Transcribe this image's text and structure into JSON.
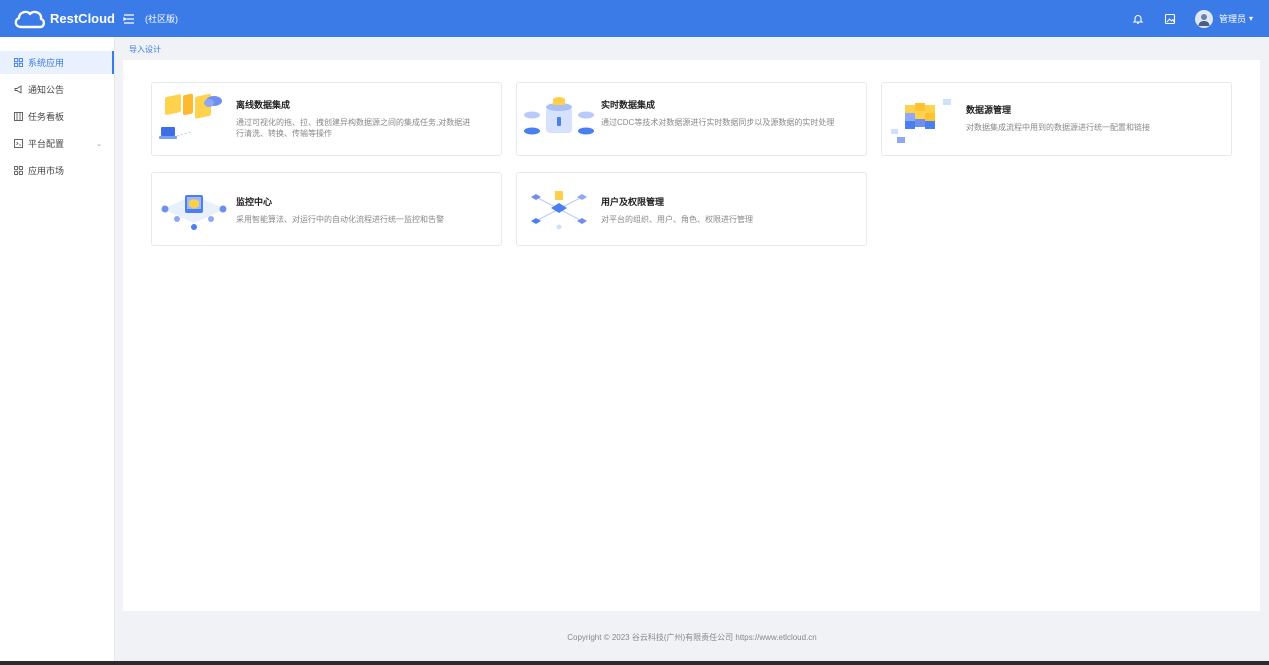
{
  "app": {
    "brand": "RestCloud",
    "edition": "(社区版)"
  },
  "header": {
    "username": "管理员"
  },
  "sidebar": {
    "items": [
      {
        "label": "系统应用",
        "icon": "grid-icon",
        "active": true
      },
      {
        "label": "通知公告",
        "icon": "megaphone-icon"
      },
      {
        "label": "任务看板",
        "icon": "board-icon"
      },
      {
        "label": "平台配置",
        "icon": "terminal-icon",
        "expandable": true
      },
      {
        "label": "应用市场",
        "icon": "apps-icon"
      }
    ]
  },
  "breadcrumb": "导入设计",
  "cards": [
    {
      "title": "离线数据集成",
      "desc": "通过可视化的拖、拉、拽创建异构数据源之间的集成任务,对数据进行清洗、转换、传输等操作",
      "icon": "etl-illustration"
    },
    {
      "title": "实时数据集成",
      "desc": "通过CDC等技术对数据源进行实时数据同步以及源数据的实时处理",
      "icon": "database-sync-illustration"
    },
    {
      "title": "数据源管理",
      "desc": "对数据集成流程中用到的数据源进行统一配置和链接",
      "icon": "datasource-blocks-illustration"
    },
    {
      "title": "监控中心",
      "desc": "采用智能算法、对运行中的自动化流程进行统一监控和告警",
      "icon": "monitor-illustration"
    },
    {
      "title": "用户及权限管理",
      "desc": "对平台的组织、用户、角色、权限进行管理",
      "icon": "users-network-illustration"
    }
  ],
  "footer": "Copyright © 2023   谷云科技(广州)有限责任公司   https://www.etlcloud.cn",
  "colors": {
    "primary": "#3b7be8",
    "background": "#f0f2f5"
  }
}
